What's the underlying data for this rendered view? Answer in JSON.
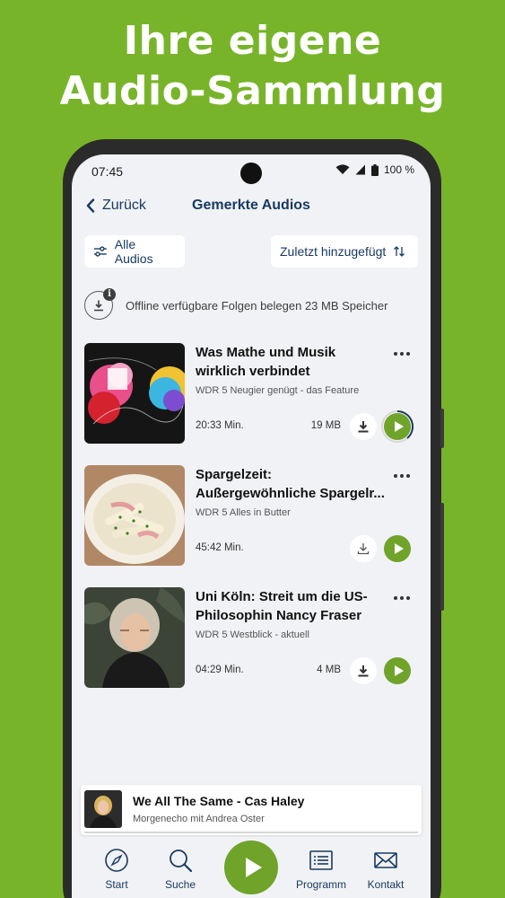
{
  "headline": {
    "line1": "Ihre eigene",
    "line2": "Audio-Sammlung"
  },
  "statusbar": {
    "time": "07:45",
    "battery": "100 %"
  },
  "nav": {
    "back_label": "Zurück",
    "title": "Gemerkte Audios"
  },
  "filters": {
    "all_label": "Alle Audios",
    "sort_label": "Zuletzt hinzugefügt"
  },
  "offline": {
    "text": "Offline verfügbare Folgen belegen 23 MB Speicher",
    "badge": "i"
  },
  "items": [
    {
      "title1": "Was Mathe und Musik",
      "title2": "wirklich verbindet",
      "subtitle": "WDR 5 Neugier genügt - das Feature",
      "duration": "20:33 Min.",
      "size": "19 MB"
    },
    {
      "title1": "Spargelzeit:",
      "title2": "Außergewöhnliche Spargelr...",
      "subtitle": "WDR 5 Alles in Butter",
      "duration": "45:42 Min.",
      "size": ""
    },
    {
      "title1": "Uni Köln: Streit um die US-",
      "title2": "Philosophin Nancy Fraser",
      "subtitle": "WDR 5 Westblick - aktuell",
      "duration": "04:29 Min.",
      "size": "4 MB"
    }
  ],
  "mini_player": {
    "title": "We All The Same - Cas Haley",
    "subtitle": "Morgenecho mit Andrea Oster"
  },
  "tabs": {
    "start": "Start",
    "suche": "Suche",
    "programm": "Programm",
    "kontakt": "Kontakt"
  },
  "colors": {
    "background": "#78b42a",
    "accent": "#6fa32a",
    "text_primary": "#183a61"
  }
}
